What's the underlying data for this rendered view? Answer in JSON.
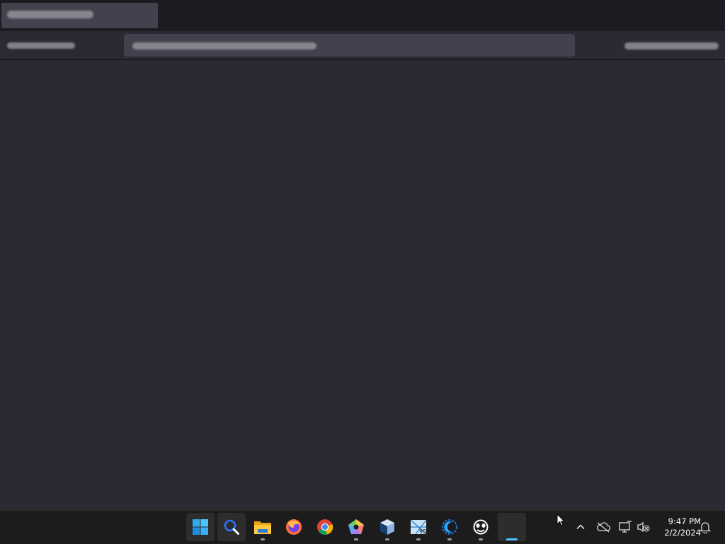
{
  "window": {
    "tab": {
      "label": ""
    },
    "toolbar": {
      "left_label": "",
      "url": "",
      "right_label": ""
    }
  },
  "taskbar": {
    "apps": [
      {
        "name": "start-icon"
      },
      {
        "name": "search-icon"
      },
      {
        "name": "file-explorer-icon"
      },
      {
        "name": "firefox-icon"
      },
      {
        "name": "chrome-icon"
      },
      {
        "name": "colorful-pentagon-app-icon"
      },
      {
        "name": "virtualbox-icon"
      },
      {
        "name": "sheet-95-app-icon"
      },
      {
        "name": "eclipse-icon"
      },
      {
        "name": "robot-face-app-icon"
      },
      {
        "name": "active-window-icon"
      }
    ],
    "tray": {
      "time": "9:47 PM",
      "date": "2/2/2024"
    }
  },
  "colors": {
    "accent": "#4cc2ff",
    "background": "#2b2a33",
    "taskbar": "#1c1c1c"
  }
}
